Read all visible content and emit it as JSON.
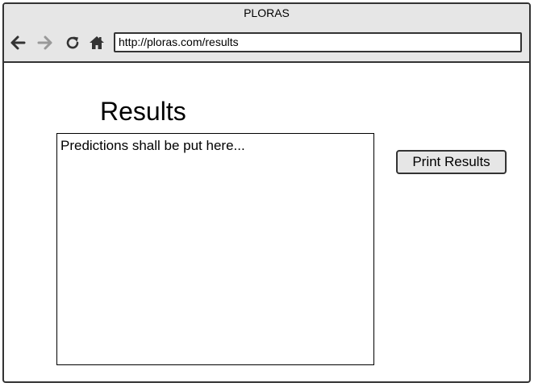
{
  "window": {
    "title": "PLORAS"
  },
  "navigation": {
    "back_icon": "arrow-left-icon",
    "forward_icon": "arrow-right-icon",
    "reload_icon": "reload-icon",
    "home_icon": "home-icon",
    "forward_disabled_color": "#999999",
    "icon_color": "#333333"
  },
  "address_bar": {
    "url": "http://ploras.com/results"
  },
  "page": {
    "title": "Results",
    "results_text": "Predictions shall be put here...",
    "print_button_label": "Print Results"
  },
  "colors": {
    "chrome_background": "#e6e6e6",
    "border": "#333333",
    "page_background": "#ffffff"
  }
}
